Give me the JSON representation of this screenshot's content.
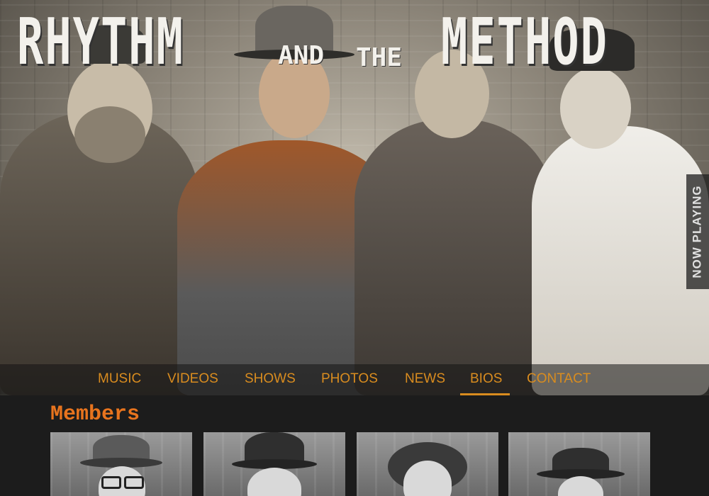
{
  "logo": {
    "word1": "RHYTHM",
    "word2": "AND",
    "word3": "THE",
    "word4": "METHOD"
  },
  "now_playing": {
    "label": "NOW PLAYING"
  },
  "nav": {
    "items": [
      {
        "label": "MUSIC"
      },
      {
        "label": "VIDEOS"
      },
      {
        "label": "SHOWS"
      },
      {
        "label": "PHOTOS"
      },
      {
        "label": "NEWS"
      },
      {
        "label": "BIOS"
      },
      {
        "label": "CONTACT"
      }
    ],
    "active": "BIOS",
    "accent_color": "#d98c1f"
  },
  "main": {
    "section_title": "Members",
    "title_color": "#e8741e"
  }
}
